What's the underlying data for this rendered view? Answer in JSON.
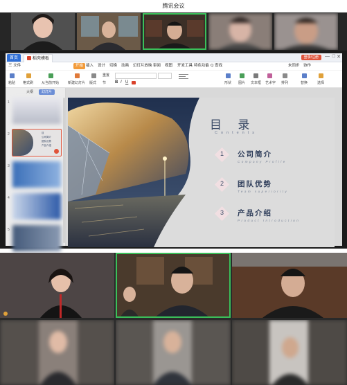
{
  "app": {
    "title": "腾讯会议"
  },
  "ppt": {
    "tabs": {
      "home": "首页",
      "doc": "稻壳模板"
    },
    "login_button": "登录/注册",
    "window_controls": {
      "minimize": "—",
      "maximize": "□",
      "close": "✕"
    },
    "menu": [
      "三 文件",
      "开始",
      "插入",
      "设计",
      "切换",
      "动画",
      "幻灯片放映",
      "审阅",
      "视图",
      "开发工具",
      "特色功能",
      "Q 查找"
    ],
    "search_placeholder": "查找",
    "sync_label": "未同步",
    "share_label": "协作",
    "toolbar": {
      "labels": [
        "粘贴",
        "格式刷",
        "从当前开始",
        "新建幻灯片",
        "版式",
        "重置",
        "节",
        "形状",
        "图片",
        "文本框",
        "艺术字",
        "排列",
        "替换",
        "选择"
      ]
    },
    "side_tabs": [
      "大纲",
      "幻灯片"
    ],
    "thumb_numbers": [
      "1",
      "2",
      "3",
      "4",
      "5"
    ],
    "thumb2_lines": [
      "目",
      "公司简介",
      "团队优势",
      "产品介绍"
    ],
    "slide": {
      "title": "目 录",
      "subtitle": "Contents",
      "items": [
        {
          "num": "1",
          "label": "公司简介",
          "en": "Company Profile"
        },
        {
          "num": "2",
          "label": "团队优势",
          "en": "Team superiority"
        },
        {
          "num": "3",
          "label": "产品介绍",
          "en": "Product Introduction"
        }
      ]
    }
  },
  "colors": {
    "active_speaker": "#3ac05a",
    "wps_home_tab": "#2f6fd6",
    "slide_navy": "#3a4a66",
    "toc_diamond": "#f1dfe2"
  }
}
